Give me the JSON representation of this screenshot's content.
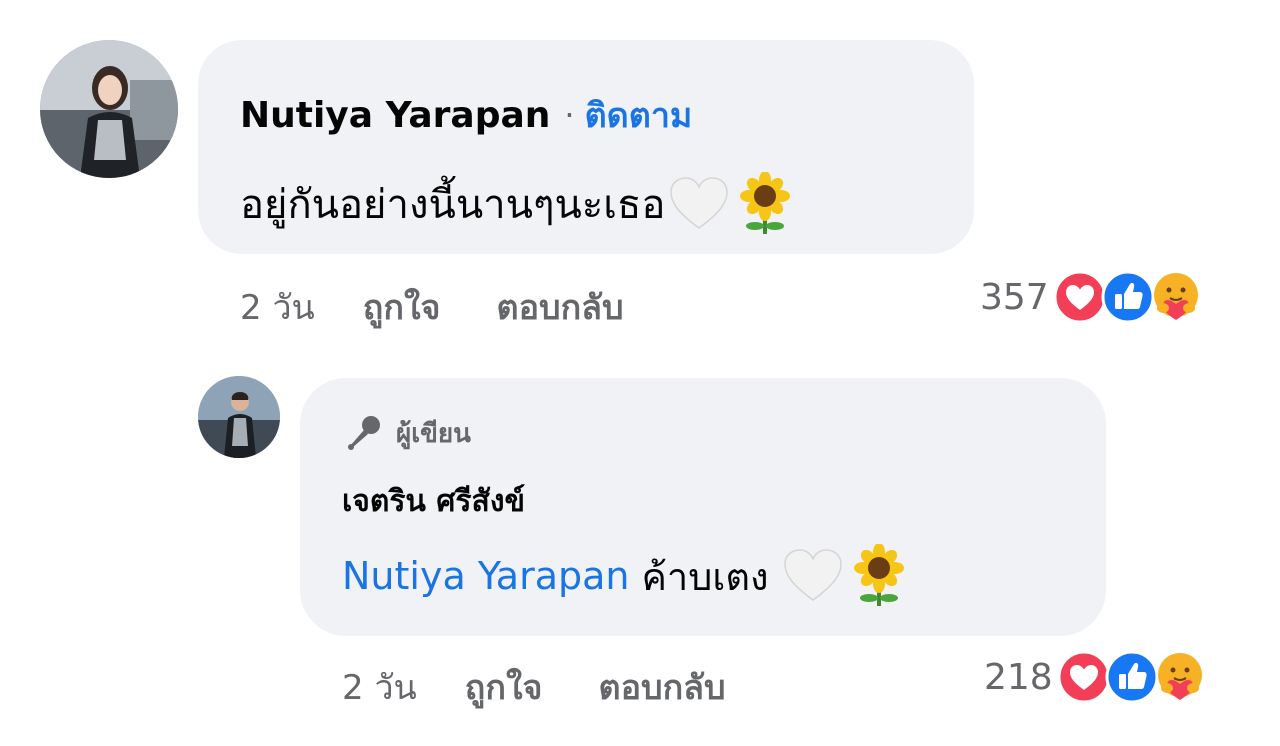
{
  "comment": {
    "author": "Nutiya Yarapan",
    "separator": "·",
    "follow_label": "ติดตาม",
    "text": "อยู่กันอย่างนี้นานๆนะเธอ",
    "emojis": [
      "white-heart-icon",
      "sunflower-icon"
    ],
    "time": "2 วัน",
    "like_label": "ถูกใจ",
    "reply_label": "ตอบกลับ",
    "reaction_count": "357",
    "reactions": [
      "love-reaction-icon",
      "like-reaction-icon",
      "care-reaction-icon"
    ]
  },
  "reply": {
    "badge_label": "ผู้เขียน",
    "badge_icon": "microphone-icon",
    "author": "เจตริน ศรีสังข์",
    "mention": "Nutiya Yarapan",
    "text": "ค้าบเตง",
    "emojis": [
      "white-heart-icon",
      "sunflower-icon"
    ],
    "time": "2 วัน",
    "like_label": "ถูกใจ",
    "reply_label": "ตอบกลับ",
    "reaction_count": "218",
    "reactions": [
      "love-reaction-icon",
      "like-reaction-icon",
      "care-reaction-icon"
    ]
  },
  "colors": {
    "bubble": "#f0f2f5",
    "link_blue": "#1b74e4",
    "secondary_text": "#65676b",
    "love_red": "#f33e58",
    "like_blue": "#1877f2",
    "care_yellow": "#f7b125"
  }
}
